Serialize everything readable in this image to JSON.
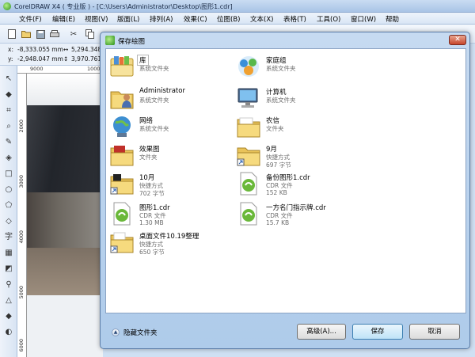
{
  "app": {
    "title": "CorelDRAW X4 ( 专业版 ) - [C:\\Users\\Administrator\\Desktop\\图形1.cdr]"
  },
  "menu": [
    "文件(F)",
    "编辑(E)",
    "视图(V)",
    "版面(L)",
    "排列(A)",
    "效果(C)",
    "位图(B)",
    "文本(X)",
    "表格(T)",
    "工具(O)",
    "窗口(W)",
    "帮助"
  ],
  "property_bar": {
    "x_label": "x:",
    "x_value": "-8,333.055 mm",
    "y_label": "y:",
    "y_value": "-2,948.047 mm",
    "w_value": "5,294.348",
    "h_value": "3,970.761"
  },
  "ruler": {
    "h_ticks": [
      "9000",
      "10000"
    ],
    "v_ticks": [
      "2000",
      "3000",
      "4000",
      "5000",
      "6000"
    ]
  },
  "dialog": {
    "title": "保存绘图",
    "close_glyph": "✕",
    "items": [
      {
        "name": "库",
        "l2": "系统文件夹",
        "l3": "",
        "icon": "library-icon"
      },
      {
        "name": "家庭组",
        "l2": "系统文件夹",
        "l3": "",
        "icon": "homegroup-icon"
      },
      {
        "name": "Administrator",
        "l2": "系统文件夹",
        "l3": "",
        "icon": "user-folder-icon"
      },
      {
        "name": "计算机",
        "l2": "系统文件夹",
        "l3": "",
        "icon": "computer-icon"
      },
      {
        "name": "网络",
        "l2": "系统文件夹",
        "l3": "",
        "icon": "network-icon"
      },
      {
        "name": "农信",
        "l2": "文件夹",
        "l3": "",
        "icon": "folder-icon"
      },
      {
        "name": "效果图",
        "l2": "文件夹",
        "l3": "",
        "icon": "folder-icon"
      },
      {
        "name": "9月",
        "l2": "快捷方式",
        "l3": "697 字节",
        "icon": "shortcut-icon"
      },
      {
        "name": "10月",
        "l2": "快捷方式",
        "l3": "702 字节",
        "icon": "shortcut-icon"
      },
      {
        "name": "备份图形1.cdr",
        "l2": "CDR 文件",
        "l3": "152 KB",
        "icon": "cdr-file-icon"
      },
      {
        "name": "图形1.cdr",
        "l2": "CDR 文件",
        "l3": "1.30 MB",
        "icon": "cdr-file-icon"
      },
      {
        "name": "一方名门指示牌.cdr",
        "l2": "CDR 文件",
        "l3": "15.7 KB",
        "icon": "cdr-file-icon"
      },
      {
        "name": "桌面文件10.19整理",
        "l2": "快捷方式",
        "l3": "650 字节",
        "icon": "shortcut-icon"
      }
    ],
    "hide_folders": "隐藏文件夹",
    "advanced_button": "高级(A)...",
    "save_button": "保存",
    "cancel_button": "取消"
  }
}
